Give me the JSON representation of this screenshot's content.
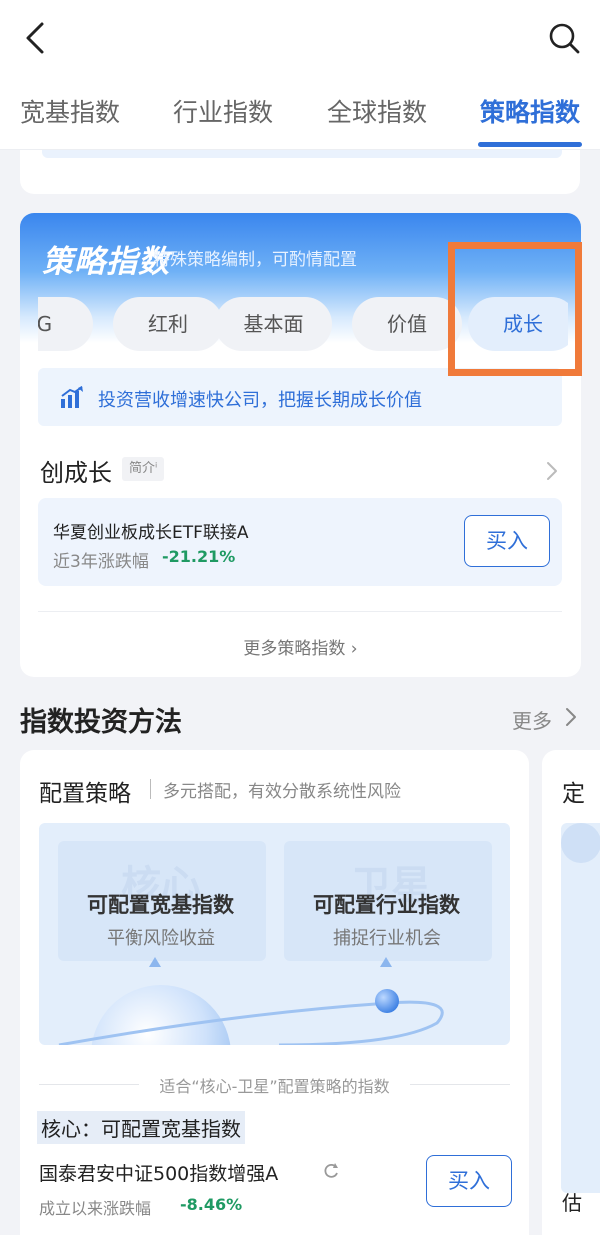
{
  "nav": {
    "back_icon": "chevron-left-icon",
    "search_icon": "search-icon"
  },
  "tabs": [
    {
      "label": "宽基指数",
      "active": false
    },
    {
      "label": "行业指数",
      "active": false
    },
    {
      "label": "全球指数",
      "active": false
    },
    {
      "label": "策略指数",
      "active": true
    }
  ],
  "strategy": {
    "title": "策略指数",
    "subtitle": "特殊策略编制，可酌情配置",
    "chips": [
      {
        "label": "SG",
        "active": false
      },
      {
        "label": "红利",
        "active": false
      },
      {
        "label": "基本面",
        "active": false
      },
      {
        "label": "价值",
        "active": false
      },
      {
        "label": "成长",
        "active": true
      }
    ],
    "tip": "投资营收增速快公司，把握长期成长价值",
    "index_name": "创成长",
    "intro_tag": "简介ⁱ",
    "fund": {
      "name": "华夏创业板成长ETF联接A",
      "stat_label": "近3年涨跌幅",
      "stat_value": "-21.21%",
      "buy_label": "买入"
    },
    "more_label": "更多策略指数 ›"
  },
  "methods": {
    "section_title": "指数投资方法",
    "more_label": "更多",
    "card": {
      "title": "配置策略",
      "subtitle": "多元搭配，有效分散系统性风险",
      "core": {
        "watermark": "核心",
        "title": "可配置宽基指数",
        "sub": "平衡风险收益"
      },
      "satellite": {
        "watermark": "卫星",
        "title": "可配置行业指数",
        "sub": "捕捉行业机会"
      },
      "suit_label": "适合“核心-卫星”配置策略的指数",
      "core_label": "核心：可配置宽基指数",
      "fund": {
        "name": "国泰君安中证500指数增强A",
        "stat_label": "成立以来涨跌幅",
        "stat_value": "-8.46%",
        "buy_label": "买入"
      }
    },
    "peek_card": {
      "title": "定",
      "bottom": "估"
    }
  },
  "colors": {
    "accent": "#2f6fd8",
    "down_green": "#1f9a63",
    "highlight_orange": "#f07a3a"
  }
}
